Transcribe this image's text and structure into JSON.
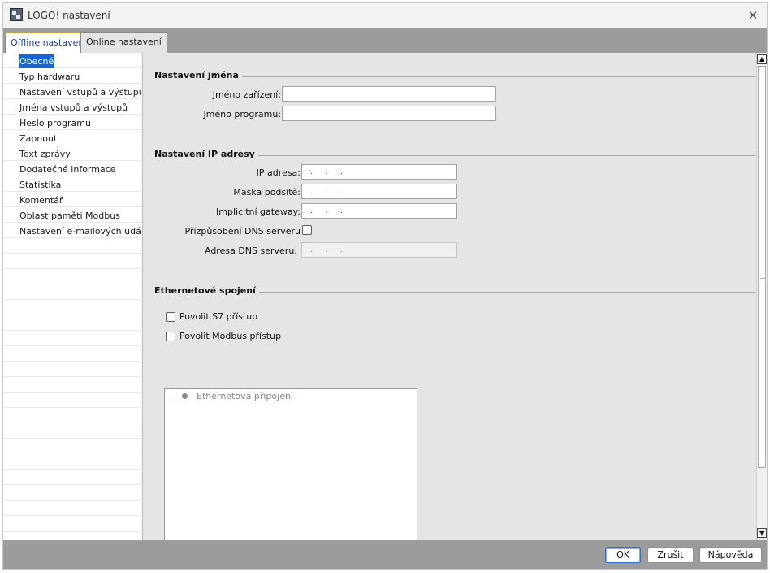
{
  "window": {
    "title": "LOGO! nastavení"
  },
  "tabs": [
    {
      "label": "Offline nastavení",
      "active": true
    },
    {
      "label": "Online nastavení",
      "active": false
    }
  ],
  "sidebar": {
    "items": [
      {
        "label": "Obecné",
        "selected": true
      },
      {
        "label": "Typ hardwaru"
      },
      {
        "label": "Nastavení vstupů a výstupů"
      },
      {
        "label": "Jména vstupů a výstupů"
      },
      {
        "label": "Heslo programu"
      },
      {
        "label": "Zapnout"
      },
      {
        "label": "Text zprávy"
      },
      {
        "label": "Dodatečné informace"
      },
      {
        "label": "Statistika"
      },
      {
        "label": "Komentář"
      },
      {
        "label": "Oblast paměti Modbus"
      },
      {
        "label": "Nastavení e-mailových událostí"
      }
    ]
  },
  "name_settings": {
    "header": "Nastavení jména",
    "device_name_label": "Jméno zařízení:",
    "device_name_value": "",
    "program_name_label": "Jméno programu:",
    "program_name_value": ""
  },
  "ip_settings": {
    "header": "Nastavení IP adresy",
    "ip_label": "IP adresa:",
    "ip_value": ". . .",
    "mask_label": "Maska podsítě:",
    "mask_value": ". . .",
    "gateway_label": "Implicitní gateway:",
    "gateway_value": ". . .",
    "dns_custom_label": "Přizpůsobení DNS serveru",
    "dns_custom_checked": false,
    "dns_address_label": "Adresa DNS serveru:",
    "dns_address_value": ". . ."
  },
  "ethernet": {
    "header": "Ethernetové spojení",
    "s7_label": "Povolit S7 přístup",
    "s7_checked": false,
    "modbus_label": "Povolit Modbus přístup",
    "modbus_checked": false,
    "tree_root": "Ethernetová připojení"
  },
  "buttons": {
    "ok": "OK",
    "cancel": "Zrušit",
    "help": "Nápověda"
  },
  "colors": {
    "accent": "#1565d8",
    "tab_highlight": "#e2951f",
    "bars": "#9c9c9c"
  }
}
